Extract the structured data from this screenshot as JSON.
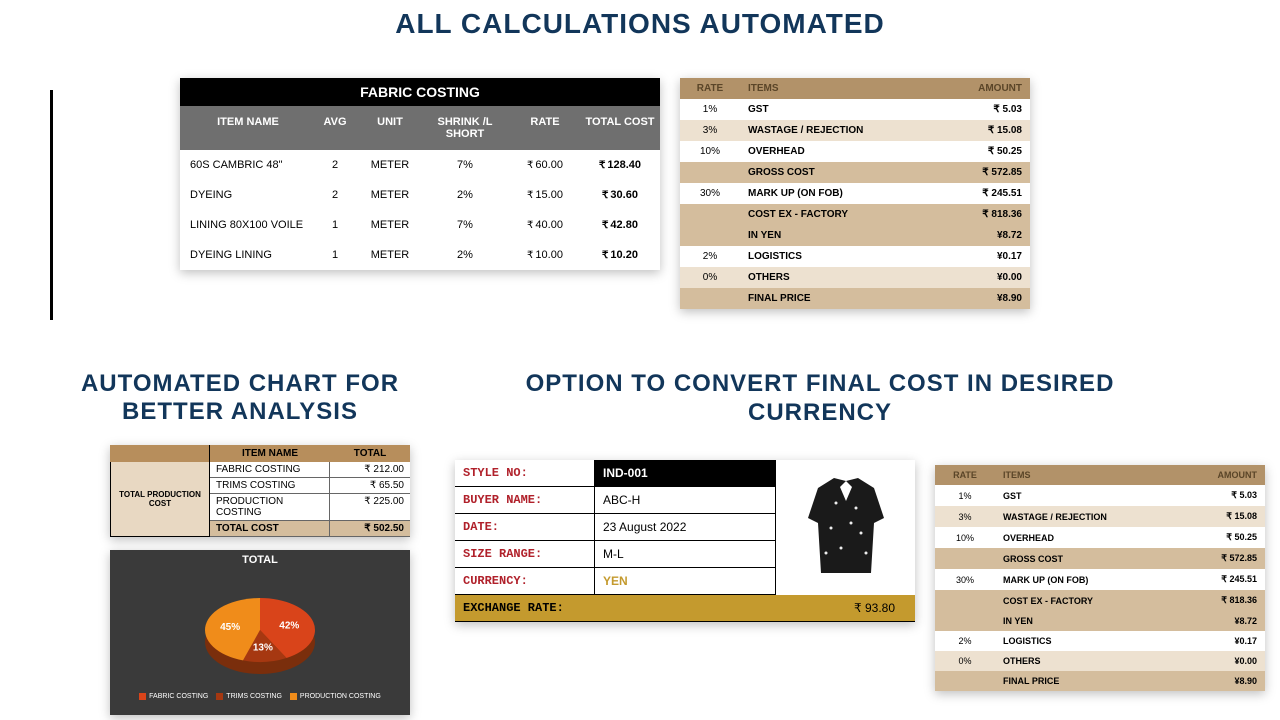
{
  "headlines": {
    "h1": "ALL CALCULATIONS AUTOMATED",
    "h2": "AUTOMATED CHART FOR BETTER  ANALYSIS",
    "h3": "OPTION TO CONVERT FINAL COST IN DESIRED CURRENCY"
  },
  "fabric": {
    "title": "FABRIC COSTING",
    "headers": {
      "name": "ITEM NAME",
      "avg": "AVG",
      "unit": "UNIT",
      "shrink": "SHRINK /L SHORT",
      "rate": "RATE",
      "total": "TOTAL COST"
    },
    "rows": [
      {
        "name": "60S CAMBRIC 48\"",
        "avg": "2",
        "unit": "METER",
        "shrink": "7%",
        "rate": "60.00",
        "total": "128.40"
      },
      {
        "name": "DYEING",
        "avg": "2",
        "unit": "METER",
        "shrink": "2%",
        "rate": "15.00",
        "total": "30.60"
      },
      {
        "name": "LINING 80X100 VOILE",
        "avg": "1",
        "unit": "METER",
        "shrink": "7%",
        "rate": "40.00",
        "total": "42.80"
      },
      {
        "name": "DYEING LINING",
        "avg": "1",
        "unit": "METER",
        "shrink": "2%",
        "rate": "10.00",
        "total": "10.20"
      }
    ]
  },
  "ria": {
    "headers": {
      "rate": "RATE",
      "items": "ITEMS",
      "amount": "AMOUNT"
    },
    "rows": [
      {
        "cls": "rw",
        "rate": "1%",
        "items": "GST",
        "amount": "₹ 5.03"
      },
      {
        "cls": "ra",
        "rate": "3%",
        "items": "WASTAGE / REJECTION",
        "amount": "₹ 15.08"
      },
      {
        "cls": "rw",
        "rate": "10%",
        "items": "OVERHEAD",
        "amount": "₹ 50.25"
      },
      {
        "cls": "rh",
        "rate": "",
        "items": "GROSS COST",
        "amount": "₹ 572.85"
      },
      {
        "cls": "rw",
        "rate": "30%",
        "items": "MARK UP (ON FOB)",
        "amount": "₹ 245.51"
      },
      {
        "cls": "rh",
        "rate": "",
        "items": "COST EX - FACTORY",
        "amount": "₹ 818.36"
      },
      {
        "cls": "rh",
        "rate": "",
        "items": "IN YEN",
        "amount": "¥8.72"
      },
      {
        "cls": "rw",
        "rate": "2%",
        "items": "LOGISTICS",
        "amount": "¥0.17"
      },
      {
        "cls": "ra",
        "rate": "0%",
        "items": "OTHERS",
        "amount": "¥0.00"
      },
      {
        "cls": "rh",
        "rate": "",
        "items": "FINAL PRICE",
        "amount": "¥8.90"
      }
    ]
  },
  "prod": {
    "label": "TOTAL PRODUCTION COST",
    "headers": {
      "item": "ITEM NAME",
      "total": "TOTAL"
    },
    "rows": [
      {
        "item": "FABRIC COSTING",
        "total": "212.00"
      },
      {
        "item": "TRIMS COSTING",
        "total": "65.50"
      },
      {
        "item": "PRODUCTION COSTING",
        "total": "225.00"
      }
    ],
    "totalrow": {
      "item": "TOTAL COST",
      "total": "502.50"
    }
  },
  "chart_data": {
    "type": "pie",
    "title": "TOTAL",
    "series": [
      {
        "name": "FABRIC COSTING",
        "value": 42,
        "label": "42%",
        "color": "#d9441a"
      },
      {
        "name": "TRIMS COSTING",
        "value": 13,
        "label": "13%",
        "color": "#a63811"
      },
      {
        "name": "PRODUCTION COSTING",
        "value": 45,
        "label": "45%",
        "color": "#f08c1a"
      }
    ],
    "legend": [
      "FABRIC COSTING",
      "TRIMS COSTING",
      "PRODUCTION COSTING"
    ]
  },
  "style": {
    "fields": {
      "style_no": {
        "label": "STYLE NO:",
        "value": "IND-001"
      },
      "buyer": {
        "label": "BUYER NAME:",
        "value": "ABC-H"
      },
      "date": {
        "label": "DATE:",
        "value": "23 August 2022"
      },
      "size": {
        "label": "SIZE RANGE:",
        "value": "M-L"
      },
      "currency": {
        "label": "CURRENCY:",
        "value": "YEN"
      },
      "exchange": {
        "label": "EXCHANGE RATE:",
        "value": "₹                         93.80"
      }
    }
  }
}
